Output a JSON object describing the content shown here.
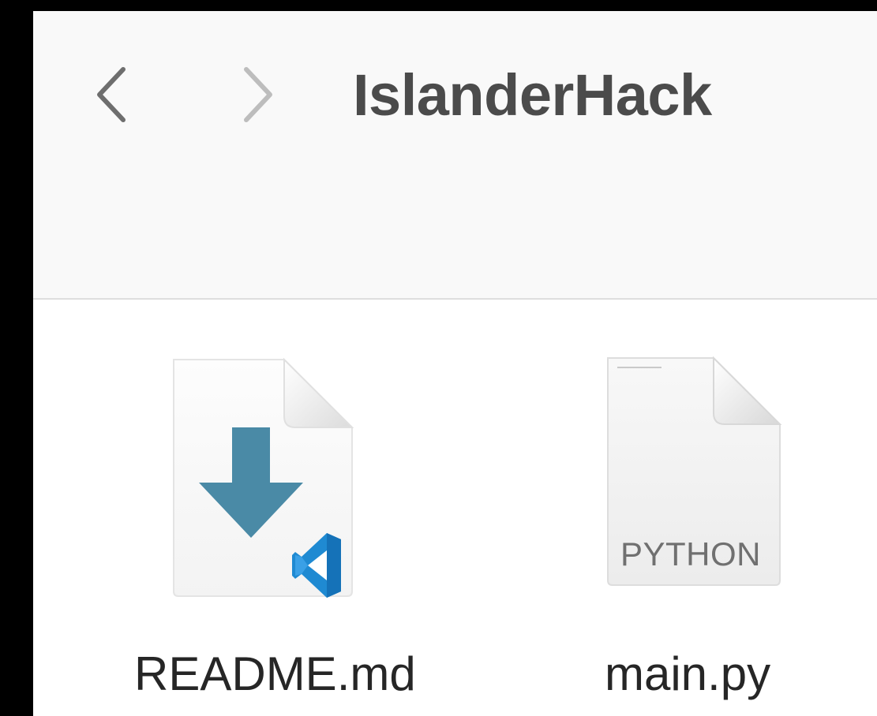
{
  "window": {
    "title": "IslanderHack"
  },
  "toolbar": {
    "back_icon": "chevron-left-icon",
    "forward_icon": "chevron-right-icon"
  },
  "files": [
    {
      "name": "README.md",
      "icon": "markdown-file-icon",
      "badge_icon": "vscode-icon"
    },
    {
      "name": "main.py",
      "icon": "python-file-icon",
      "badge_label": "PYTHON"
    }
  ],
  "colors": {
    "markdown_arrow": "#4a8aa6",
    "vscode_blue": "#1f8ad2",
    "title_text": "#4b4b4b"
  }
}
